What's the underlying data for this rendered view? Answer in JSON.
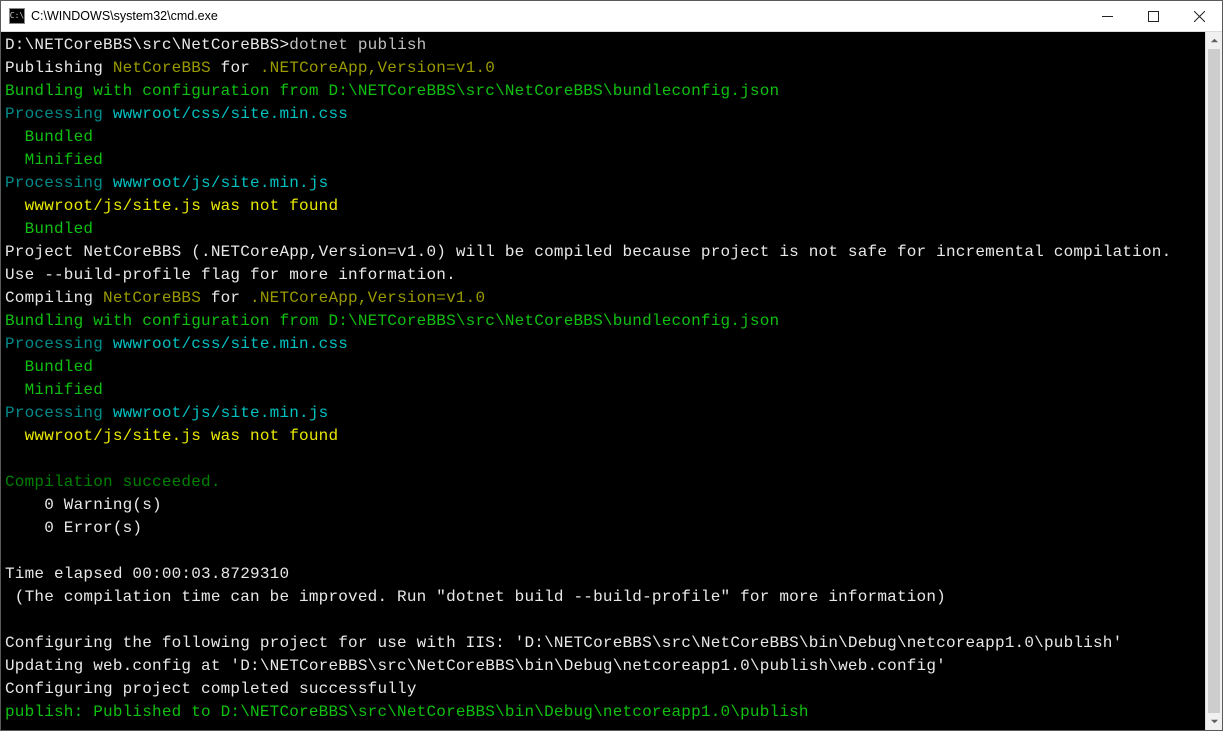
{
  "window": {
    "title": "C:\\WINDOWS\\system32\\cmd.exe",
    "icon_label": "C:\\"
  },
  "terminal": {
    "prompt": "D:\\NETCoreBBS\\src\\NetCoreBBS>",
    "command": "dotnet publish",
    "l2a": "Publishing ",
    "l2b": "NetCoreBBS",
    "l2c": " for ",
    "l2d": ".NETCoreApp,Version=v1.0",
    "l3": "Bundling with configuration from D:\\NETCoreBBS\\src\\NetCoreBBS\\bundleconfig.json",
    "l4a": "Processing ",
    "l4b": "wwwroot/css/site.min.css",
    "l5": "  Bundled",
    "l6": "  Minified",
    "l7a": "Processing ",
    "l7b": "wwwroot/js/site.min.js",
    "l8": "  wwwroot/js/site.js was not found",
    "l9": "  Bundled",
    "l10": "Project NetCoreBBS (.NETCoreApp,Version=v1.0) will be compiled because project is not safe for incremental compilation.",
    "l11": "Use --build-profile flag for more information.",
    "l12a": "Compiling ",
    "l12b": "NetCoreBBS",
    "l12c": " for ",
    "l12d": ".NETCoreApp,Version=v1.0",
    "l13": "Bundling with configuration from D:\\NETCoreBBS\\src\\NetCoreBBS\\bundleconfig.json",
    "l14a": "Processing ",
    "l14b": "wwwroot/css/site.min.css",
    "l15": "  Bundled",
    "l16": "  Minified",
    "l17a": "Processing ",
    "l17b": "wwwroot/js/site.min.js",
    "l18": "  wwwroot/js/site.js was not found",
    "blank1": "",
    "l20": "Compilation succeeded.",
    "l21": "    0 Warning(s)",
    "l22": "    0 Error(s)",
    "blank2": "",
    "l24": "Time elapsed 00:00:03.8729310",
    "l25": " (The compilation time can be improved. Run \"dotnet build --build-profile\" for more information)",
    "blank3": "",
    "l27": "Configuring the following project for use with IIS: 'D:\\NETCoreBBS\\src\\NetCoreBBS\\bin\\Debug\\netcoreapp1.0\\publish'",
    "l28": "Updating web.config at 'D:\\NETCoreBBS\\src\\NetCoreBBS\\bin\\Debug\\netcoreapp1.0\\publish\\web.config'",
    "l29": "Configuring project completed successfully",
    "l30": "publish: Published to D:\\NETCoreBBS\\src\\NetCoreBBS\\bin\\Debug\\netcoreapp1.0\\publish"
  }
}
